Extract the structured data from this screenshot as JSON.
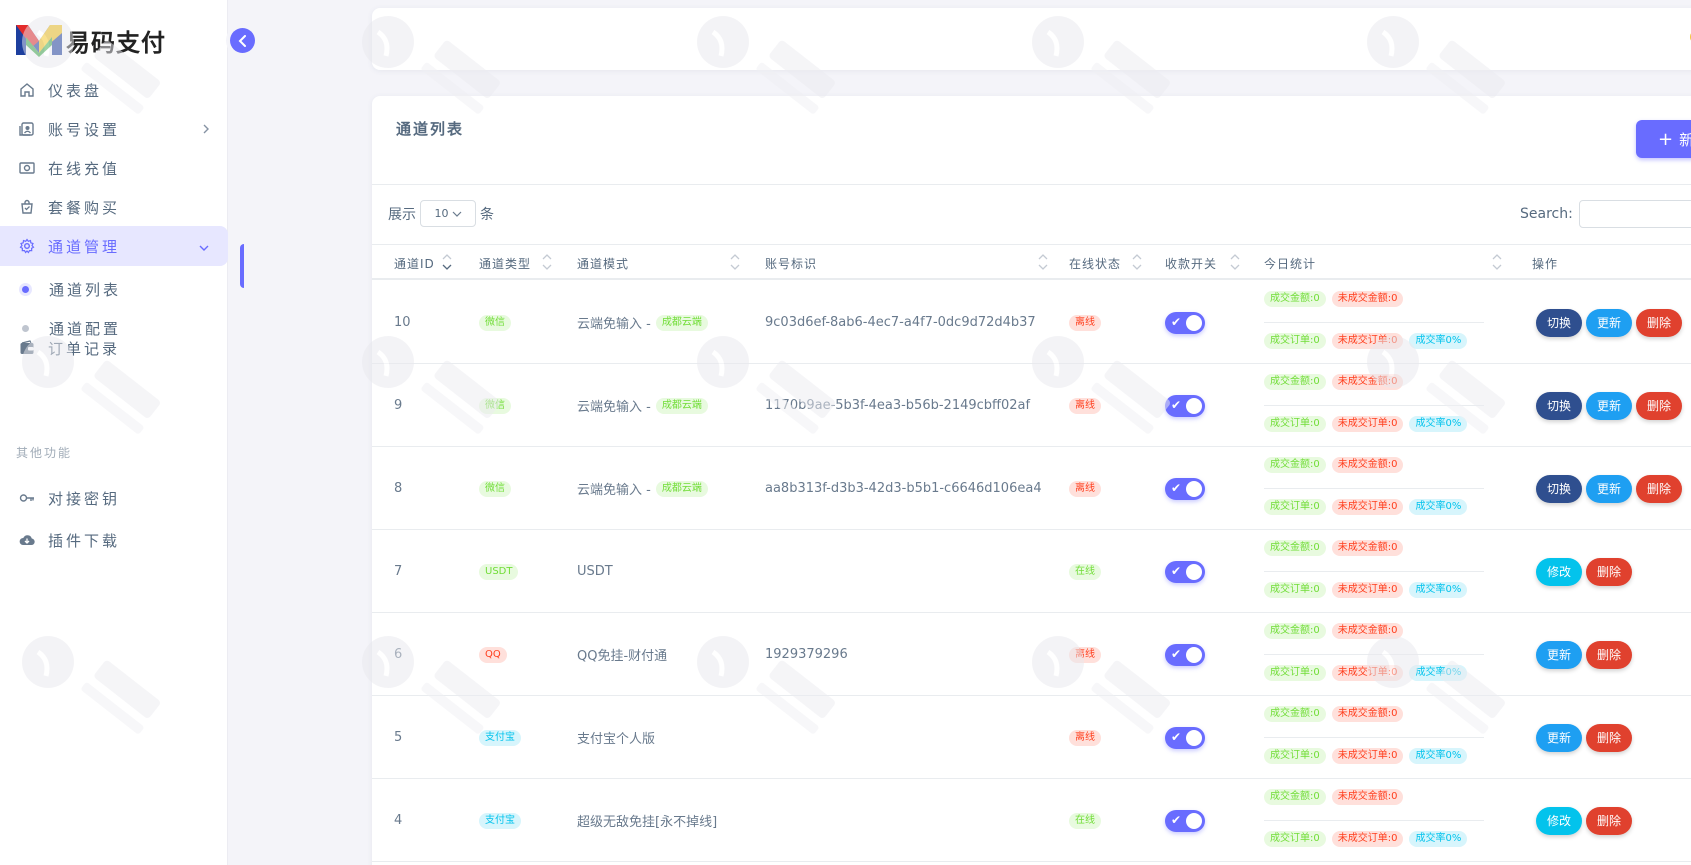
{
  "brand": {
    "name": "易码支付"
  },
  "sidebar": {
    "items": [
      {
        "label": "仪表盘",
        "icon": "home-icon"
      },
      {
        "label": "账号设置",
        "icon": "user-card-icon"
      },
      {
        "label": "在线充值",
        "icon": "money-icon"
      },
      {
        "label": "套餐购买",
        "icon": "shopping-bag-icon"
      },
      {
        "label": "通道管理",
        "icon": "gear-icon",
        "active": true
      },
      {
        "label": "订单记录",
        "icon": "wallet-icon"
      }
    ],
    "sub_items": [
      {
        "label": "通道列表",
        "current": true
      },
      {
        "label": "通道配置"
      }
    ],
    "section_header": "其他功能",
    "other_items": [
      {
        "label": "对接密钥",
        "icon": "key-icon"
      },
      {
        "label": "插件下载",
        "icon": "cloud-download-icon"
      }
    ]
  },
  "card": {
    "title": "通道列表",
    "add_label": "新"
  },
  "controls": {
    "show_label": "展示",
    "page_size": "10",
    "unit_label": "条",
    "search_label": "Search:"
  },
  "table": {
    "headers": [
      "通道ID",
      "通道类型",
      "通道模式",
      "账号标识",
      "在线状态",
      "收款开关",
      "今日统计",
      "操作"
    ],
    "stat_labels": {
      "success_amount": "成交金额:0",
      "fail_amount": "未成交金额:0",
      "success_orders": "成交订单:0",
      "fail_orders": "未成交订单:0",
      "rate": "成交率0%"
    },
    "rows": [
      {
        "id": "10",
        "type": "微信",
        "type_color": "green",
        "mode": "云端免输入 -",
        "mode_tag": "成都云端",
        "account": "9c03d6ef-8ab6-4ec7-a4f7-0dc9d72d4b37",
        "status": "离线",
        "status_color": "red",
        "actions": [
          "切换",
          "更新",
          "删除"
        ]
      },
      {
        "id": "9",
        "type": "微信",
        "type_color": "green",
        "mode": "云端免输入 -",
        "mode_tag": "成都云端",
        "account": "1170b9ae-5b3f-4ea3-b56b-2149cbff02af",
        "status": "离线",
        "status_color": "red",
        "actions": [
          "切换",
          "更新",
          "删除"
        ]
      },
      {
        "id": "8",
        "type": "微信",
        "type_color": "green",
        "mode": "云端免输入 -",
        "mode_tag": "成都云端",
        "account": "aa8b313f-d3b3-42d3-b5b1-c6646d106ea4",
        "status": "离线",
        "status_color": "red",
        "actions": [
          "切换",
          "更新",
          "删除"
        ]
      },
      {
        "id": "7",
        "type": "USDT",
        "type_color": "green",
        "mode": "USDT",
        "mode_tag": "",
        "account": "",
        "status": "在线",
        "status_color": "green",
        "actions": [
          "修改",
          "删除"
        ]
      },
      {
        "id": "6",
        "type": "QQ",
        "type_color": "red",
        "mode": "QQ免挂-财付通",
        "mode_tag": "",
        "account": "1929379296",
        "status": "离线",
        "status_color": "red",
        "actions": [
          "更新",
          "删除"
        ]
      },
      {
        "id": "5",
        "type": "支付宝",
        "type_color": "cyan",
        "mode": "支付宝个人版",
        "mode_tag": "",
        "account": "",
        "status": "离线",
        "status_color": "red",
        "actions": [
          "更新",
          "删除"
        ]
      },
      {
        "id": "4",
        "type": "支付宝",
        "type_color": "cyan",
        "mode": "超级无敌免挂[永不掉线]",
        "mode_tag": "",
        "account": "",
        "status": "在线",
        "status_color": "green",
        "actions": [
          "修改",
          "删除"
        ]
      }
    ]
  },
  "colors": {
    "primary": "#696cff",
    "success": "#71dd37",
    "danger": "#ff3e1d",
    "info": "#03c3ec"
  }
}
